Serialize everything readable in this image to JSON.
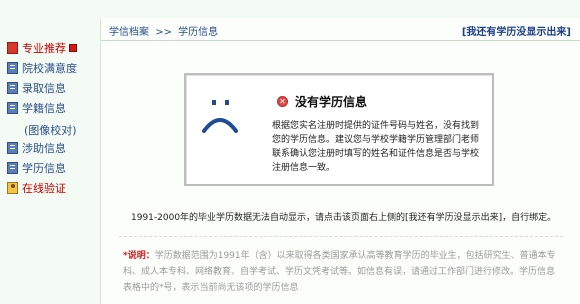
{
  "sidebar": {
    "items": [
      {
        "label": "专业推荐",
        "icon": "red-book-icon",
        "state": "active"
      },
      {
        "label": "院校满意度",
        "icon": "book-icon"
      },
      {
        "label": "录取信息",
        "icon": "book-icon"
      },
      {
        "label": "学籍信息",
        "icon": "book-icon"
      },
      {
        "label": "(图像校对)"
      },
      {
        "label": "涉助信息",
        "icon": "book-icon"
      },
      {
        "label": "学历信息",
        "icon": "book-icon"
      },
      {
        "label": "在线验证",
        "icon": "verify-icon"
      }
    ]
  },
  "header": {
    "breadcrumb": [
      "学信档案",
      "学历信息"
    ],
    "breadcrumb_sep": ">>",
    "no_record_link": "[我还有学历没显示出来]"
  },
  "message": {
    "title": "没有学历信息",
    "icon": "error-icon",
    "face": "sad-face-icon",
    "body": "根据您实名注册时提供的证件号码与姓名，没有找到您的学历信息。建议您与学校学籍学历管理部门老师联系确认您注册时填写的姓名和证件信息是否与学校注册信息一致。"
  },
  "note": "1991-2000年的毕业学历数据无法自动显示，请点击该页面右上侧的[我还有学历没显示出来]，自行绑定。",
  "explanation": {
    "label": "*说明：",
    "text": "学历数据范围为1991年（含）以来取得各类国家承认高等教育学历的毕业生，包括研究生、普通本专科、成人本专科、网络教育、自学考试、学历文凭考试等。如信息有误，请通过工作部门进行修改。学历信息表格中的*号，表示当前尚无该项的学历信息"
  },
  "colors": {
    "accent": "#2c4f8c",
    "active": "#cc0000",
    "page_bg": "#f4fbf4"
  }
}
